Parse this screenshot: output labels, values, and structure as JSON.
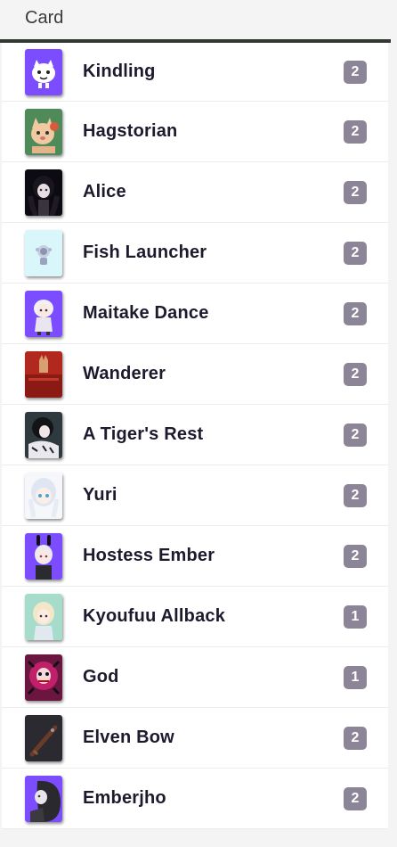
{
  "header": {
    "title": "Card"
  },
  "colors": {
    "accent": "#7b4dff",
    "badge": "#8c8598",
    "text": "#1e1a2e"
  },
  "cards": [
    {
      "name": "Kindling",
      "count": "2",
      "icon": "kindling-card-art-icon"
    },
    {
      "name": "Hagstorian",
      "count": "2",
      "icon": "hagstorian-card-art-icon"
    },
    {
      "name": "Alice",
      "count": "2",
      "icon": "alice-card-art-icon"
    },
    {
      "name": "Fish Launcher",
      "count": "2",
      "icon": "fish-launcher-card-art-icon"
    },
    {
      "name": "Maitake Dance",
      "count": "2",
      "icon": "maitake-dance-card-art-icon"
    },
    {
      "name": "Wanderer",
      "count": "2",
      "icon": "wanderer-card-art-icon"
    },
    {
      "name": "A Tiger's Rest",
      "count": "2",
      "icon": "tigers-rest-card-art-icon"
    },
    {
      "name": "Yuri",
      "count": "2",
      "icon": "yuri-card-art-icon"
    },
    {
      "name": "Hostess Ember",
      "count": "2",
      "icon": "hostess-ember-card-art-icon"
    },
    {
      "name": "Kyoufuu Allback",
      "count": "1",
      "icon": "kyoufuu-allback-card-art-icon"
    },
    {
      "name": "God",
      "count": "1",
      "icon": "god-card-art-icon"
    },
    {
      "name": "Elven Bow",
      "count": "2",
      "icon": "elven-bow-card-art-icon"
    },
    {
      "name": "Emberjho",
      "count": "2",
      "icon": "emberjho-card-art-icon"
    }
  ]
}
